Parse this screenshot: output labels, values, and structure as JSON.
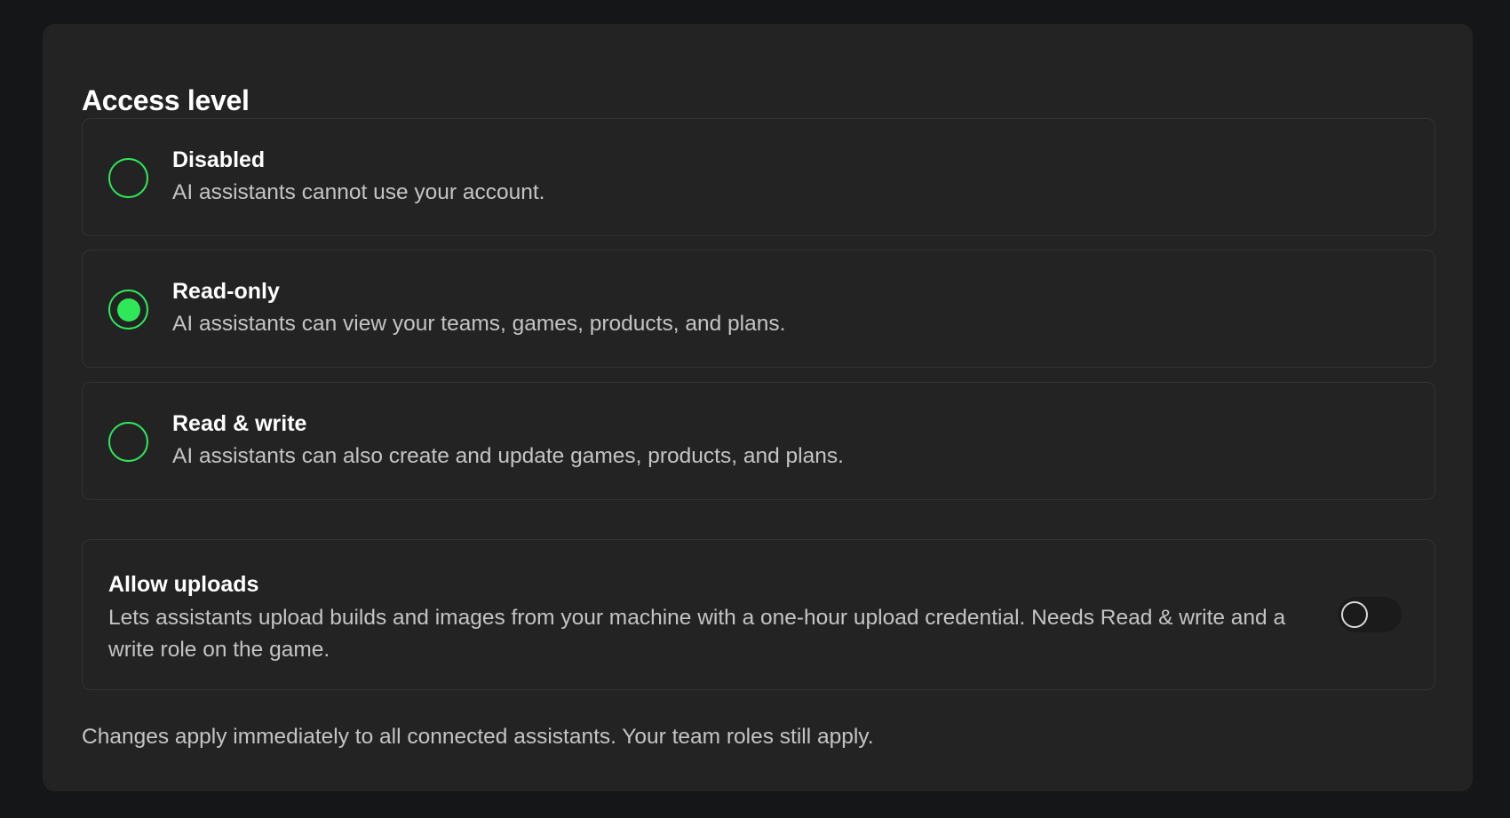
{
  "access_level": {
    "title": "Access level",
    "selected": "read_only",
    "options": [
      {
        "id": "disabled",
        "label": "Disabled",
        "description": "AI assistants cannot use your account.",
        "checked": false
      },
      {
        "id": "read_only",
        "label": "Read-only",
        "description": "AI assistants can view your teams, games, products, and plans.",
        "checked": true
      },
      {
        "id": "read_write",
        "label": "Read & write",
        "description": "AI assistants can also create and update games, products, and plans.",
        "checked": false
      }
    ]
  },
  "uploads": {
    "title": "Allow uploads",
    "description": "Lets assistants upload builds and images from your machine with a one-hour upload credential. Needs Read & write and a write role on the game.",
    "enabled": false
  },
  "footer_note": "Changes apply immediately to all connected assistants. Your team roles still apply.",
  "colors": {
    "accent": "#2ee85a",
    "panel_background": "#232323",
    "page_background": "#151618"
  },
  "icons": {
    "radio": "radio-button-icon",
    "toggle": "toggle-switch-icon"
  }
}
